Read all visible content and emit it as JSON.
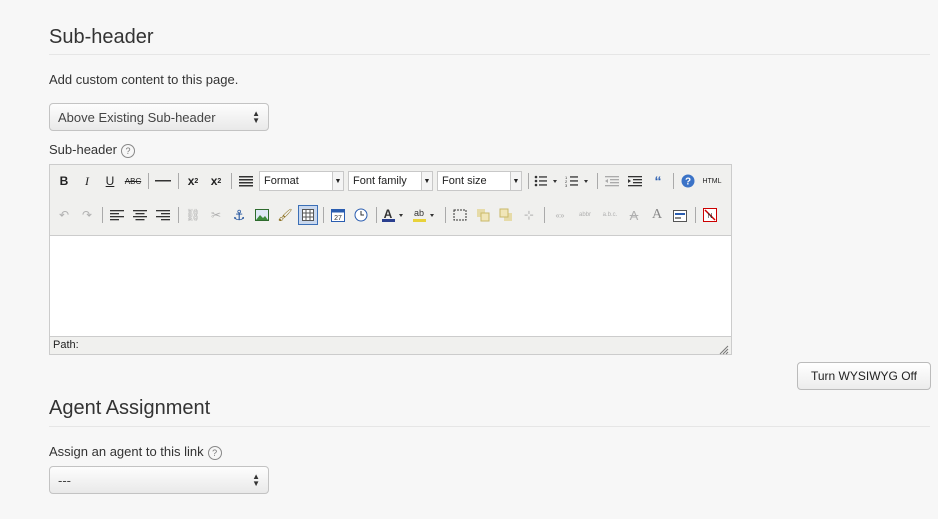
{
  "subheader_section": {
    "title": "Sub-header",
    "description": "Add custom content to this page.",
    "position_select": {
      "value": "Above Existing Sub-header"
    },
    "field_label": "Sub-header",
    "help_icon_glyph": "?"
  },
  "editor": {
    "toolbar": {
      "bold": "B",
      "italic": "I",
      "underline": "U",
      "strike": "ABC",
      "format_select": "Format",
      "font_family_select": "Font family",
      "font_size_select": "Font size",
      "html_label": "HTML"
    },
    "path_label": "Path:"
  },
  "wysiwyg_toggle": {
    "label": "Turn WYSIWYG Off"
  },
  "agent_section": {
    "title": "Agent Assignment",
    "field_label": "Assign an agent to this link",
    "help_icon_glyph": "?",
    "agent_select": {
      "value": "---"
    }
  }
}
